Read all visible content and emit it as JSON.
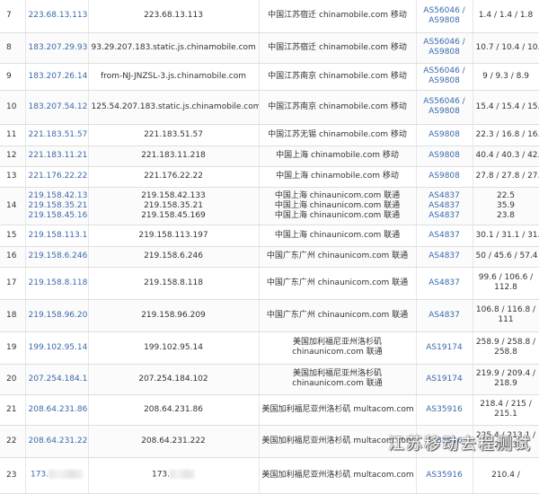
{
  "rows": [
    {
      "hop": "7",
      "ip": "223.68.13.113",
      "host": "223.68.13.113",
      "loc": [
        "中国江苏宿迁 chinamobile.com 移动"
      ],
      "asn": [
        "AS56046 /",
        "AS9808"
      ],
      "lat": [
        "1.4 / 1.4 / 1.8"
      ],
      "h": 36
    },
    {
      "hop": "8",
      "ip": "183.207.29.93",
      "host": "93.29.207.183.static.js.chinamobile.com",
      "loc": [
        "中国江苏宿迁 chinamobile.com 移动"
      ],
      "asn": [
        "AS56046 /",
        "AS9808"
      ],
      "lat": [
        "10.7 / 10.4 / 10.3"
      ],
      "h": 34
    },
    {
      "hop": "9",
      "ip": "183.207.26.146",
      "host": "from-NJ-JNZSL-3.js.chinamobile.com",
      "loc": [
        "中国江苏南京 chinamobile.com 移动"
      ],
      "asn": [
        "AS56046 /",
        "AS9808"
      ],
      "lat": [
        "9 / 9.3 / 8.9"
      ],
      "h": 30
    },
    {
      "hop": "10",
      "ip": "183.207.54.125",
      "host": "125.54.207.183.static.js.chinamobile.com",
      "loc": [
        "中国江苏南京 chinamobile.com 移动"
      ],
      "asn": [
        "AS56046 /",
        "AS9808"
      ],
      "lat": [
        "15.4 / 15.4 / 15.2"
      ],
      "h": 38
    },
    {
      "hop": "11",
      "ip": "221.183.51.57",
      "host": "221.183.51.57",
      "loc": [
        "中国江苏无锡 chinamobile.com 移动"
      ],
      "asn": [
        "AS9808"
      ],
      "lat": [
        "22.3 / 16.8 / 16.7"
      ],
      "h": 24
    },
    {
      "hop": "12",
      "ip": "221.183.11.218",
      "host": "221.183.11.218",
      "loc": [
        "中国上海 chinamobile.com 移动"
      ],
      "asn": [
        "AS9808"
      ],
      "lat": [
        "40.4 / 40.3 / 42.5"
      ],
      "h": 23
    },
    {
      "hop": "13",
      "ip": "221.176.22.22",
      "host": "221.176.22.22",
      "loc": [
        "中国上海 chinamobile.com 移动"
      ],
      "asn": [
        "AS9808"
      ],
      "lat": [
        "27.8 / 27.8 / 27.9"
      ],
      "h": 23
    },
    {
      "hop": "14",
      "ip": [
        "219.158.42.133",
        "219.158.35.21",
        "219.158.45.169"
      ],
      "host": [
        "219.158.42.133",
        "219.158.35.21",
        "219.158.45.169"
      ],
      "loc": [
        "中国上海 chinaunicom.com 联通",
        "中国上海 chinaunicom.com 联通",
        "中国上海 chinaunicom.com 联通"
      ],
      "asn": [
        "AS4837",
        "AS4837",
        "AS4837"
      ],
      "lat": [
        "22.5",
        "35.9",
        "23.8"
      ],
      "h": 42
    },
    {
      "hop": "15",
      "ip": "219.158.113.197",
      "host": "219.158.113.197",
      "loc": [
        "中国上海 chinaunicom.com 联通"
      ],
      "asn": [
        "AS4837"
      ],
      "lat": [
        "30.1 / 31.1 / 31.5"
      ],
      "h": 24
    },
    {
      "hop": "16",
      "ip": "219.158.6.246",
      "host": "219.158.6.246",
      "loc": [
        "中国广东广州 chinaunicom.com 联通"
      ],
      "asn": [
        "AS4837"
      ],
      "lat": [
        "50 / 45.6 / 57.4"
      ],
      "h": 23
    },
    {
      "hop": "17",
      "ip": "219.158.8.118",
      "host": "219.158.8.118",
      "loc": [
        "中国广东广州 chinaunicom.com 联通"
      ],
      "asn": [
        "AS4837"
      ],
      "lat": [
        "99.6 / 106.6 /",
        "112.8"
      ],
      "h": 36
    },
    {
      "hop": "18",
      "ip": "219.158.96.209",
      "host": "219.158.96.209",
      "loc": [
        "中国广东广州 chinaunicom.com 联通"
      ],
      "asn": [
        "AS4837"
      ],
      "lat": [
        "106.8 / 116.8 /",
        "111"
      ],
      "h": 36
    },
    {
      "hop": "19",
      "ip": "199.102.95.14",
      "host": "199.102.95.14",
      "loc": [
        "美国加利福尼亚州洛杉矶",
        "chinaunicom.com 联通"
      ],
      "asn": [
        "AS19174"
      ],
      "lat": [
        "258.9 / 258.8 /",
        "258.8"
      ],
      "h": 36
    },
    {
      "hop": "20",
      "ip": "207.254.184.102",
      "host": "207.254.184.102",
      "loc": [
        "美国加利福尼亚州洛杉矶",
        "chinaunicom.com 联通"
      ],
      "asn": [
        "AS19174"
      ],
      "lat": [
        "219.9 / 209.4 /",
        "218.9"
      ],
      "h": 34
    },
    {
      "hop": "21",
      "ip": "208.64.231.86",
      "host": "208.64.231.86",
      "loc": [
        "美国加利福尼亚州洛杉矶 multacom.com"
      ],
      "asn": [
        "AS35916"
      ],
      "lat": [
        "218.4 / 215 /",
        "215.1"
      ],
      "h": 34
    },
    {
      "hop": "22",
      "ip": "208.64.231.222",
      "host": "208.64.231.222",
      "loc": [
        "美国加利福尼亚州洛杉矶 multacom.com"
      ],
      "asn": [
        "AS35916"
      ],
      "lat": [
        "225.4 / 213.1 /",
        "203.3"
      ],
      "h": 36
    },
    {
      "hop": "23",
      "ip": "173.",
      "host": "173.",
      "loc": [
        "美国加利福尼亚州洛杉矶 multacom.com"
      ],
      "asn": [
        "AS35916"
      ],
      "lat": [
        "210.4 /"
      ],
      "h": 40,
      "redacted": true
    }
  ],
  "watermark": "江苏移动去程测试"
}
